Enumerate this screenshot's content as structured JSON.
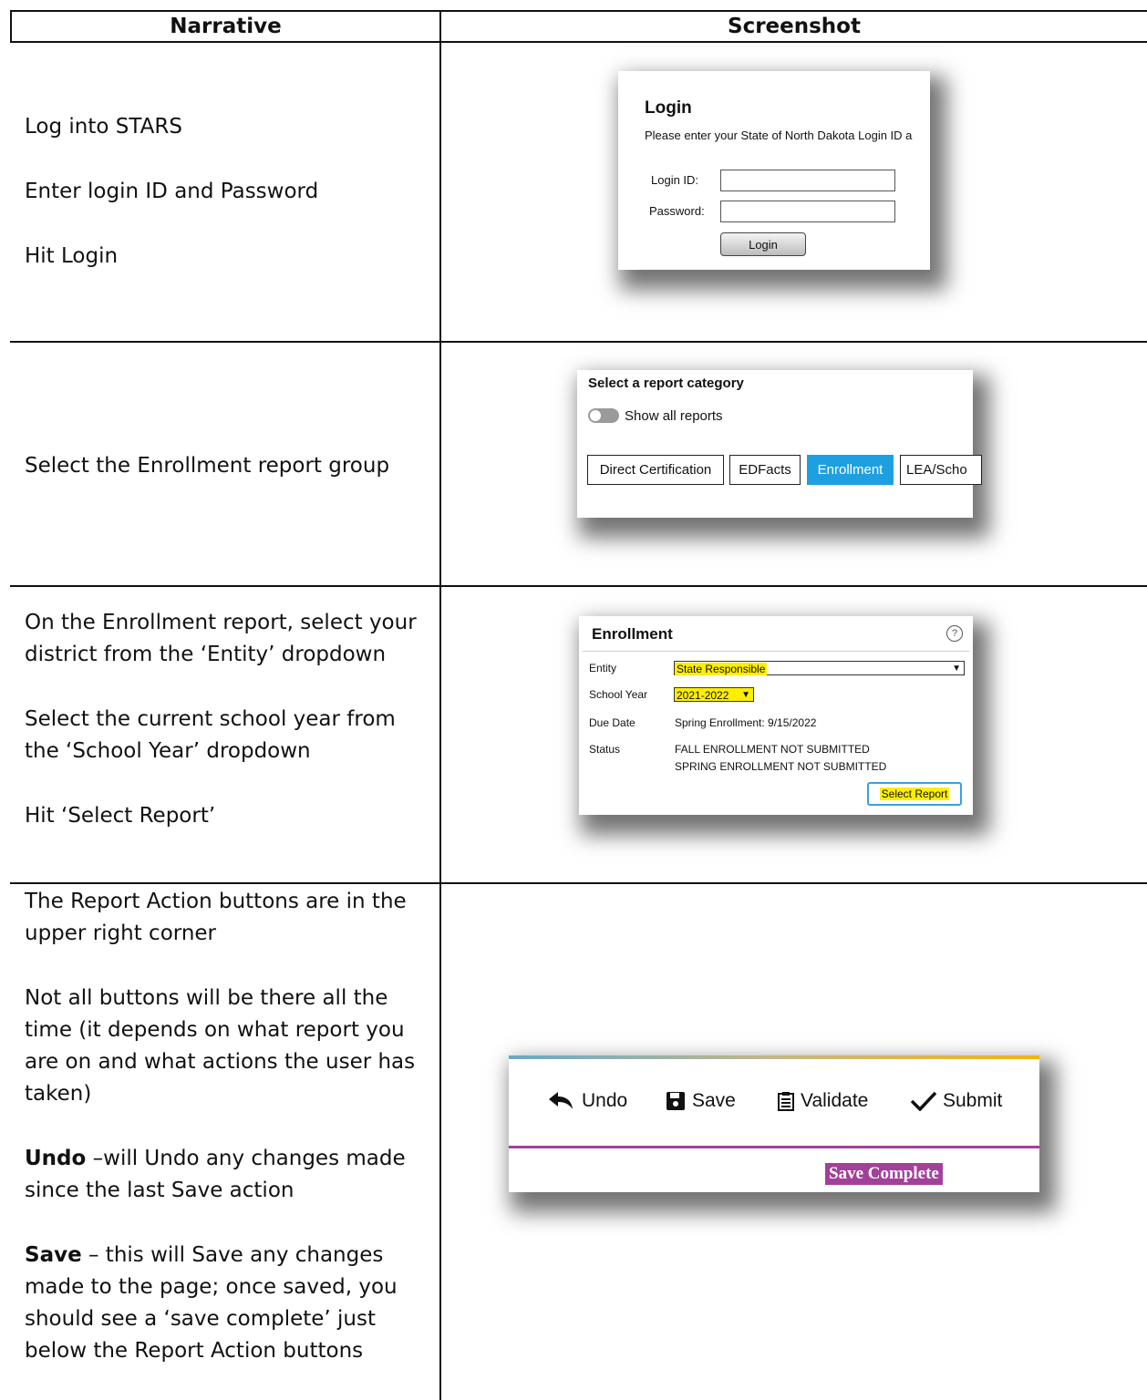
{
  "table": {
    "col_narrative": "Narrative",
    "col_screenshot": "Screenshot"
  },
  "row1": {
    "lines": [
      "Log into STARS",
      "Enter login ID and Password",
      "Hit Login"
    ],
    "shot": {
      "title": "Login",
      "subtitle": "Please enter your State of North Dakota Login ID a",
      "login_id_label": "Login ID:",
      "password_label": "Password:",
      "login_button": "Login"
    }
  },
  "row2": {
    "lines": [
      "Select the Enrollment report group"
    ],
    "shot": {
      "title": "Select a report category",
      "toggle_label": "Show all reports",
      "categories": [
        "Direct Certification",
        "EDFacts",
        "Enrollment",
        "LEA/Scho"
      ],
      "accent": "#1ea0e0"
    }
  },
  "row3": {
    "para1": "On the Enrollment report, select your district from the ‘Entity’ dropdown",
    "para2": "Select the current school year from the ‘School Year’ dropdown",
    "para3": "Hit ‘Select Report’",
    "shot": {
      "title": "Enrollment",
      "entity_label": "Entity",
      "entity_value": "State Responsible",
      "year_label": "School Year",
      "year_value": "2021-2022",
      "due_label": "Due Date",
      "due_value": "Spring Enrollment: 9/15/2022",
      "status_label": "Status",
      "status_line1": "FALL ENROLLMENT NOT SUBMITTED",
      "status_line2": "SPRING ENROLLMENT NOT SUBMITTED",
      "select_button": "Select Report"
    }
  },
  "row4": {
    "para1": "The Report Action buttons are in the upper right corner",
    "para2": "Not all buttons will be there all the time (it depends on what report you are on and what actions the user has taken)",
    "undo_term": "Undo",
    "undo_desc": " –will Undo any changes made since the last Save action",
    "save_term": "Save",
    "save_desc": " – this will Save any changes made to the page; once saved, you should see a ‘save complete’ just below the Report Action buttons",
    "shot": {
      "undo": "Undo",
      "save": "Save",
      "validate": "Validate",
      "submit": "Submit",
      "save_complete": "Save Complete",
      "accent_purple": "#a2419a"
    }
  }
}
